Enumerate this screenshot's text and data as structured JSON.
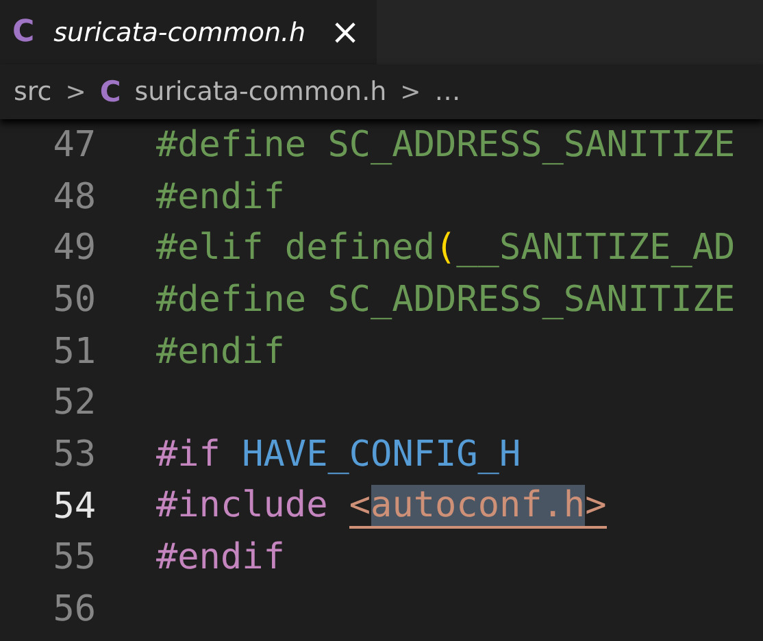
{
  "tab": {
    "icon_text": "C",
    "title": "suricata-common.h",
    "close": "×",
    "preview": true
  },
  "breadcrumbs": [
    {
      "text": "src"
    },
    {
      "text": "suricata-common.h",
      "icon_text": "C"
    },
    {
      "text": "…"
    }
  ],
  "separator": ">",
  "lines": [
    {
      "number": "47",
      "current": false,
      "tokens": [
        {
          "text": "#define SC_ADDRESS_SANITIZE",
          "kind": "inactive",
          "selected": false
        }
      ]
    },
    {
      "number": "48",
      "current": false,
      "tokens": [
        {
          "text": "#endif",
          "kind": "inactive",
          "selected": false
        }
      ]
    },
    {
      "number": "49",
      "current": false,
      "tokens": [
        {
          "text": "#elif defined",
          "kind": "inactive",
          "selected": false
        },
        {
          "text": "(",
          "kind": "paren",
          "selected": false
        },
        {
          "text": "__SANITIZE_AD",
          "kind": "inactive",
          "selected": false
        }
      ]
    },
    {
      "number": "50",
      "current": false,
      "tokens": [
        {
          "text": "#define SC_ADDRESS_SANITIZE",
          "kind": "inactive",
          "selected": false
        }
      ]
    },
    {
      "number": "51",
      "current": false,
      "tokens": [
        {
          "text": "#endif",
          "kind": "inactive",
          "selected": false
        }
      ]
    },
    {
      "number": "52",
      "current": false
    },
    {
      "number": "53",
      "current": false,
      "tokens": [
        {
          "text": "#if ",
          "kind": "directive",
          "selected": false
        },
        {
          "text": "HAVE_CONFIG_H",
          "kind": "macro",
          "selected": false
        }
      ]
    },
    {
      "number": "54",
      "current": true,
      "tokens": [
        {
          "text": "#include ",
          "kind": "directive",
          "selected": false
        },
        {
          "text": "<",
          "kind": "path",
          "selected": false
        },
        {
          "text": "autoconf.h",
          "kind": "path",
          "selected": true
        },
        {
          "text": ">",
          "kind": "path",
          "selected": false
        }
      ]
    },
    {
      "number": "55",
      "current": false,
      "tokens": [
        {
          "text": "#endif",
          "kind": "directive",
          "selected": false
        }
      ]
    },
    {
      "number": "56",
      "current": false
    }
  ]
}
